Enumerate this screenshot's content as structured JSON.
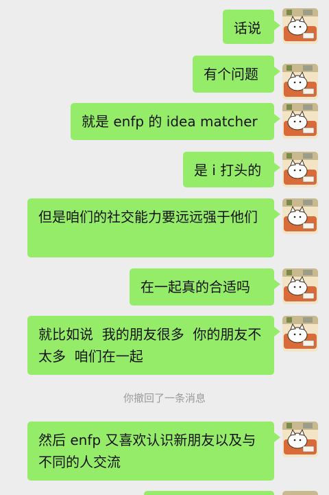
{
  "chat": {
    "messages": [
      {
        "text": "话说"
      },
      {
        "text": "有个问题"
      },
      {
        "text": "就是 enfp 的 idea matcher"
      },
      {
        "text": "是 i 打头的"
      },
      {
        "text": "但是咱们的社交能力要远远强于他们"
      },
      {
        "text": "在一起真的合适吗"
      },
      {
        "text": "就比如说  我的朋友很多  你的朋友不太多  咱们在一起"
      },
      {
        "text": "然后 enfp 又喜欢认识新朋友以及与不同的人交流"
      }
    ],
    "recall_notice": "你撤回了一条消息"
  },
  "colors": {
    "background": "#ededed",
    "bubble_self": "#95ec69",
    "recall_text": "#9a9a9a"
  },
  "icons": {
    "avatar": "cat-on-sofa-avatar-icon"
  }
}
